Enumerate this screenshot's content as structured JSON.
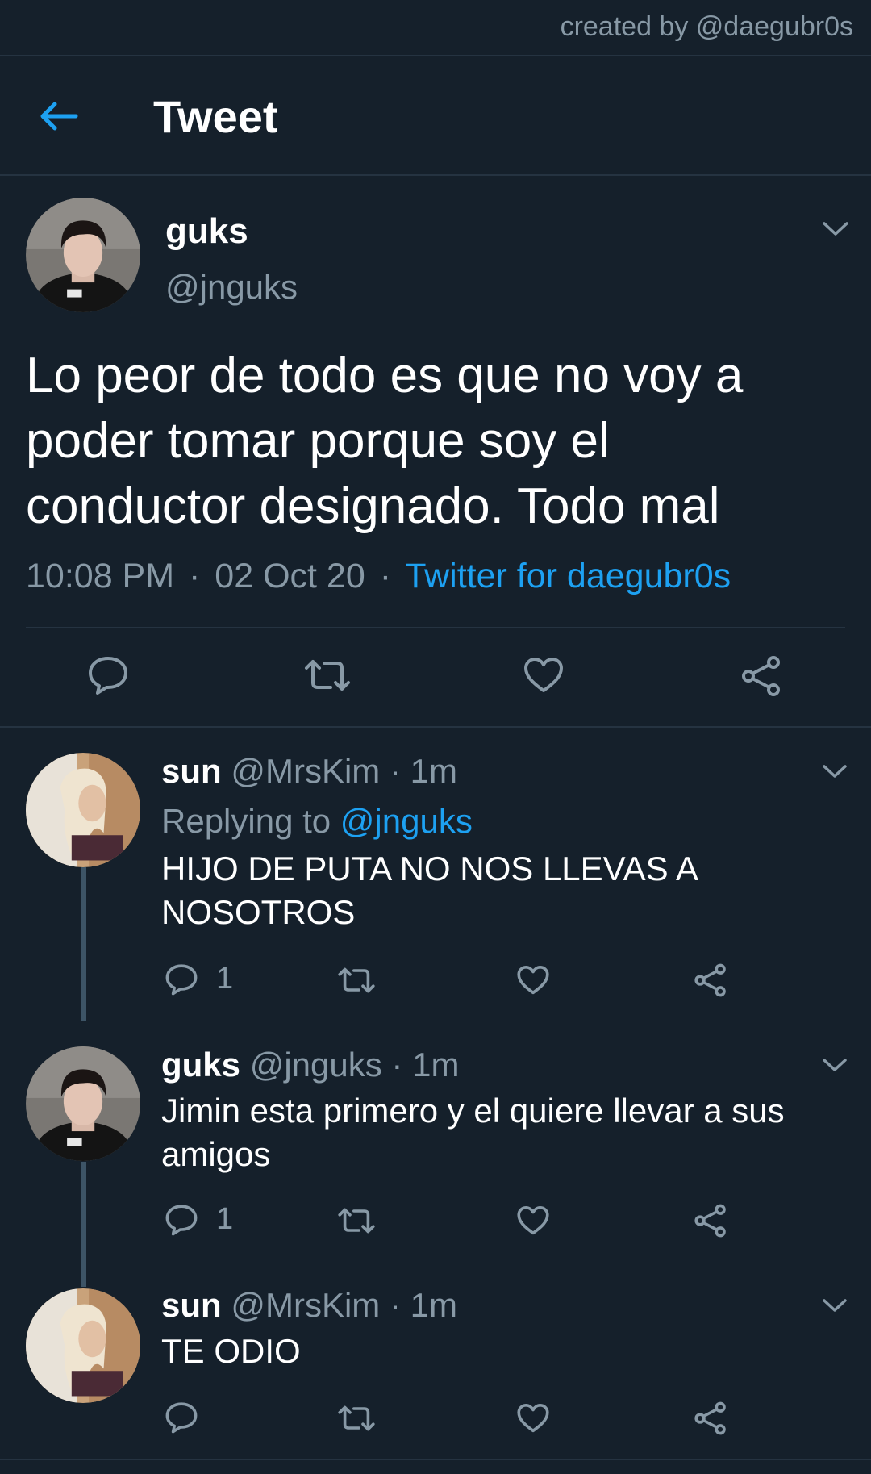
{
  "watermark": "created by @daegubr0s",
  "header": {
    "title": "Tweet"
  },
  "main_tweet": {
    "name": "guks",
    "handle": "@jnguks",
    "text": "Lo peor de todo es que no voy a poder tomar porque soy el conductor designado. Todo mal",
    "time": "10:08 PM",
    "date": "02 Oct 20",
    "source": "Twitter for daegubr0s",
    "separator": "·"
  },
  "replies": [
    {
      "name": "sun",
      "handle": "@MrsKim",
      "time": "1m",
      "replying_label": "Replying to",
      "replying_to": "@jnguks",
      "text": "HIJO DE PUTA NO NOS LLEVAS A NOSOTROS",
      "reply_count": "1"
    },
    {
      "name": "guks",
      "handle": "@jnguks",
      "time": "1m",
      "text": "Jimin esta primero y el quiere llevar a sus amigos",
      "reply_count": "1"
    },
    {
      "name": "sun",
      "handle": "@MrsKim",
      "time": "1m",
      "text": "TE ODIO"
    }
  ],
  "colors": {
    "background": "#15202b",
    "accent": "#1da1f2",
    "muted": "#8899a6",
    "divider": "#253341"
  },
  "icons": [
    "back-arrow-icon",
    "chevron-down-icon",
    "reply-icon",
    "retweet-icon",
    "like-icon",
    "share-icon"
  ]
}
